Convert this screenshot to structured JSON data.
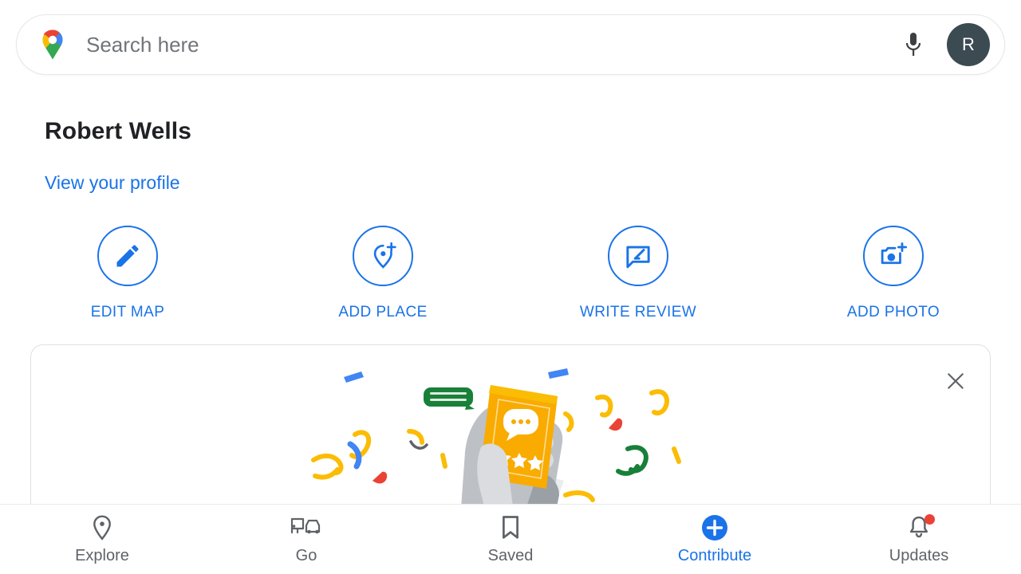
{
  "search": {
    "placeholder": "Search here",
    "value": "",
    "logo_icon": "google-maps-pin-icon",
    "mic_icon": "microphone-icon",
    "avatar_initial": "R"
  },
  "profile": {
    "name": "Robert Wells",
    "view_profile_label": "View your profile"
  },
  "actions": [
    {
      "label": "EDIT MAP",
      "icon": "pencil-icon"
    },
    {
      "label": "ADD PLACE",
      "icon": "add-place-pin-icon"
    },
    {
      "label": "WRITE REVIEW",
      "icon": "review-bubble-icon"
    },
    {
      "label": "ADD PHOTO",
      "icon": "add-photo-camera-icon"
    }
  ],
  "promo_card": {
    "close_icon": "close-icon",
    "illustration": "hand-holding-phone-review-confetti-illustration"
  },
  "bottom_nav": [
    {
      "label": "Explore",
      "icon": "location-pin-icon",
      "active": false,
      "badge": false
    },
    {
      "label": "Go",
      "icon": "commute-bus-car-icon",
      "active": false,
      "badge": false
    },
    {
      "label": "Saved",
      "icon": "bookmark-icon",
      "active": false,
      "badge": false
    },
    {
      "label": "Contribute",
      "icon": "plus-circle-icon",
      "active": true,
      "badge": false
    },
    {
      "label": "Updates",
      "icon": "bell-icon",
      "active": false,
      "badge": true
    }
  ],
  "colors": {
    "accent_blue": "#1a73e8",
    "text_primary": "#202124",
    "text_secondary": "#5f6368",
    "badge_red": "#ea4335",
    "avatar_bg": "#3c4a52",
    "illustration_orange": "#f9ab00",
    "illustration_green": "#188038"
  }
}
